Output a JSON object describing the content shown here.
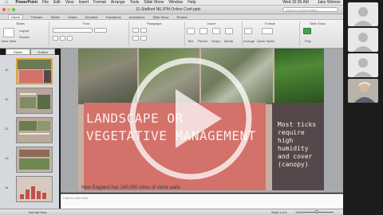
{
  "menubar": {
    "app": "PowerPoint",
    "items": [
      "File",
      "Edit",
      "View",
      "Insert",
      "Format",
      "Arrange",
      "Tools",
      "Slide Show",
      "Window",
      "Help"
    ],
    "clock": "Wed 10:36 AM",
    "user": "Jake Weimer"
  },
  "window": {
    "doc_title": "11-Stafford NE IPM Online Conf.pptx",
    "search_placeholder": "Search in Presentation",
    "traffic_colors": [
      "#ec5f57",
      "#f4bf4f",
      "#62c554"
    ]
  },
  "ribbon": {
    "tabs": [
      "Home",
      "Themes",
      "Tables",
      "Charts",
      "SmartArt",
      "Transitions",
      "Animations",
      "Slide Show",
      "Review"
    ],
    "active_tab": "Home",
    "groups": [
      "Slides",
      "Font",
      "Paragraph",
      "Insert",
      "Format",
      "Slide Show"
    ],
    "labels": {
      "new_slide": "New Slide",
      "layout": "Layout",
      "section": "Section",
      "text": "Text",
      "picture": "Picture",
      "shape": "Shape",
      "media": "Media",
      "arrange": "Arrange",
      "quick_styles": "Quick Styles",
      "play": "Play"
    }
  },
  "left_pane": {
    "tabs": [
      "Slides",
      "Outline"
    ],
    "active_tab": "Slides",
    "thumbnails": [
      {
        "number": "10",
        "selected": true
      },
      {
        "number": "11",
        "selected": false
      },
      {
        "number": "12",
        "selected": false
      },
      {
        "number": "13",
        "selected": false
      },
      {
        "number": "14",
        "selected": false
      }
    ]
  },
  "slide": {
    "title_line1": "LANDSCAPE OR",
    "title_line2": "VEGETATIVE MANAGEMENT",
    "side_lines": [
      "Most ticks",
      "require",
      "high",
      "humidity",
      "and cover",
      "(canopy)"
    ],
    "subtitle": "New England has 240,000 miles of stone walls"
  },
  "notes": {
    "placeholder": "Click to add notes"
  },
  "status": {
    "view": "Normal View",
    "slide_count": "Slide 1 of 1",
    "zoom": "113%"
  },
  "overlay": {
    "icon": "play-icon",
    "color": "#ffffff",
    "opacity": 0.75
  }
}
